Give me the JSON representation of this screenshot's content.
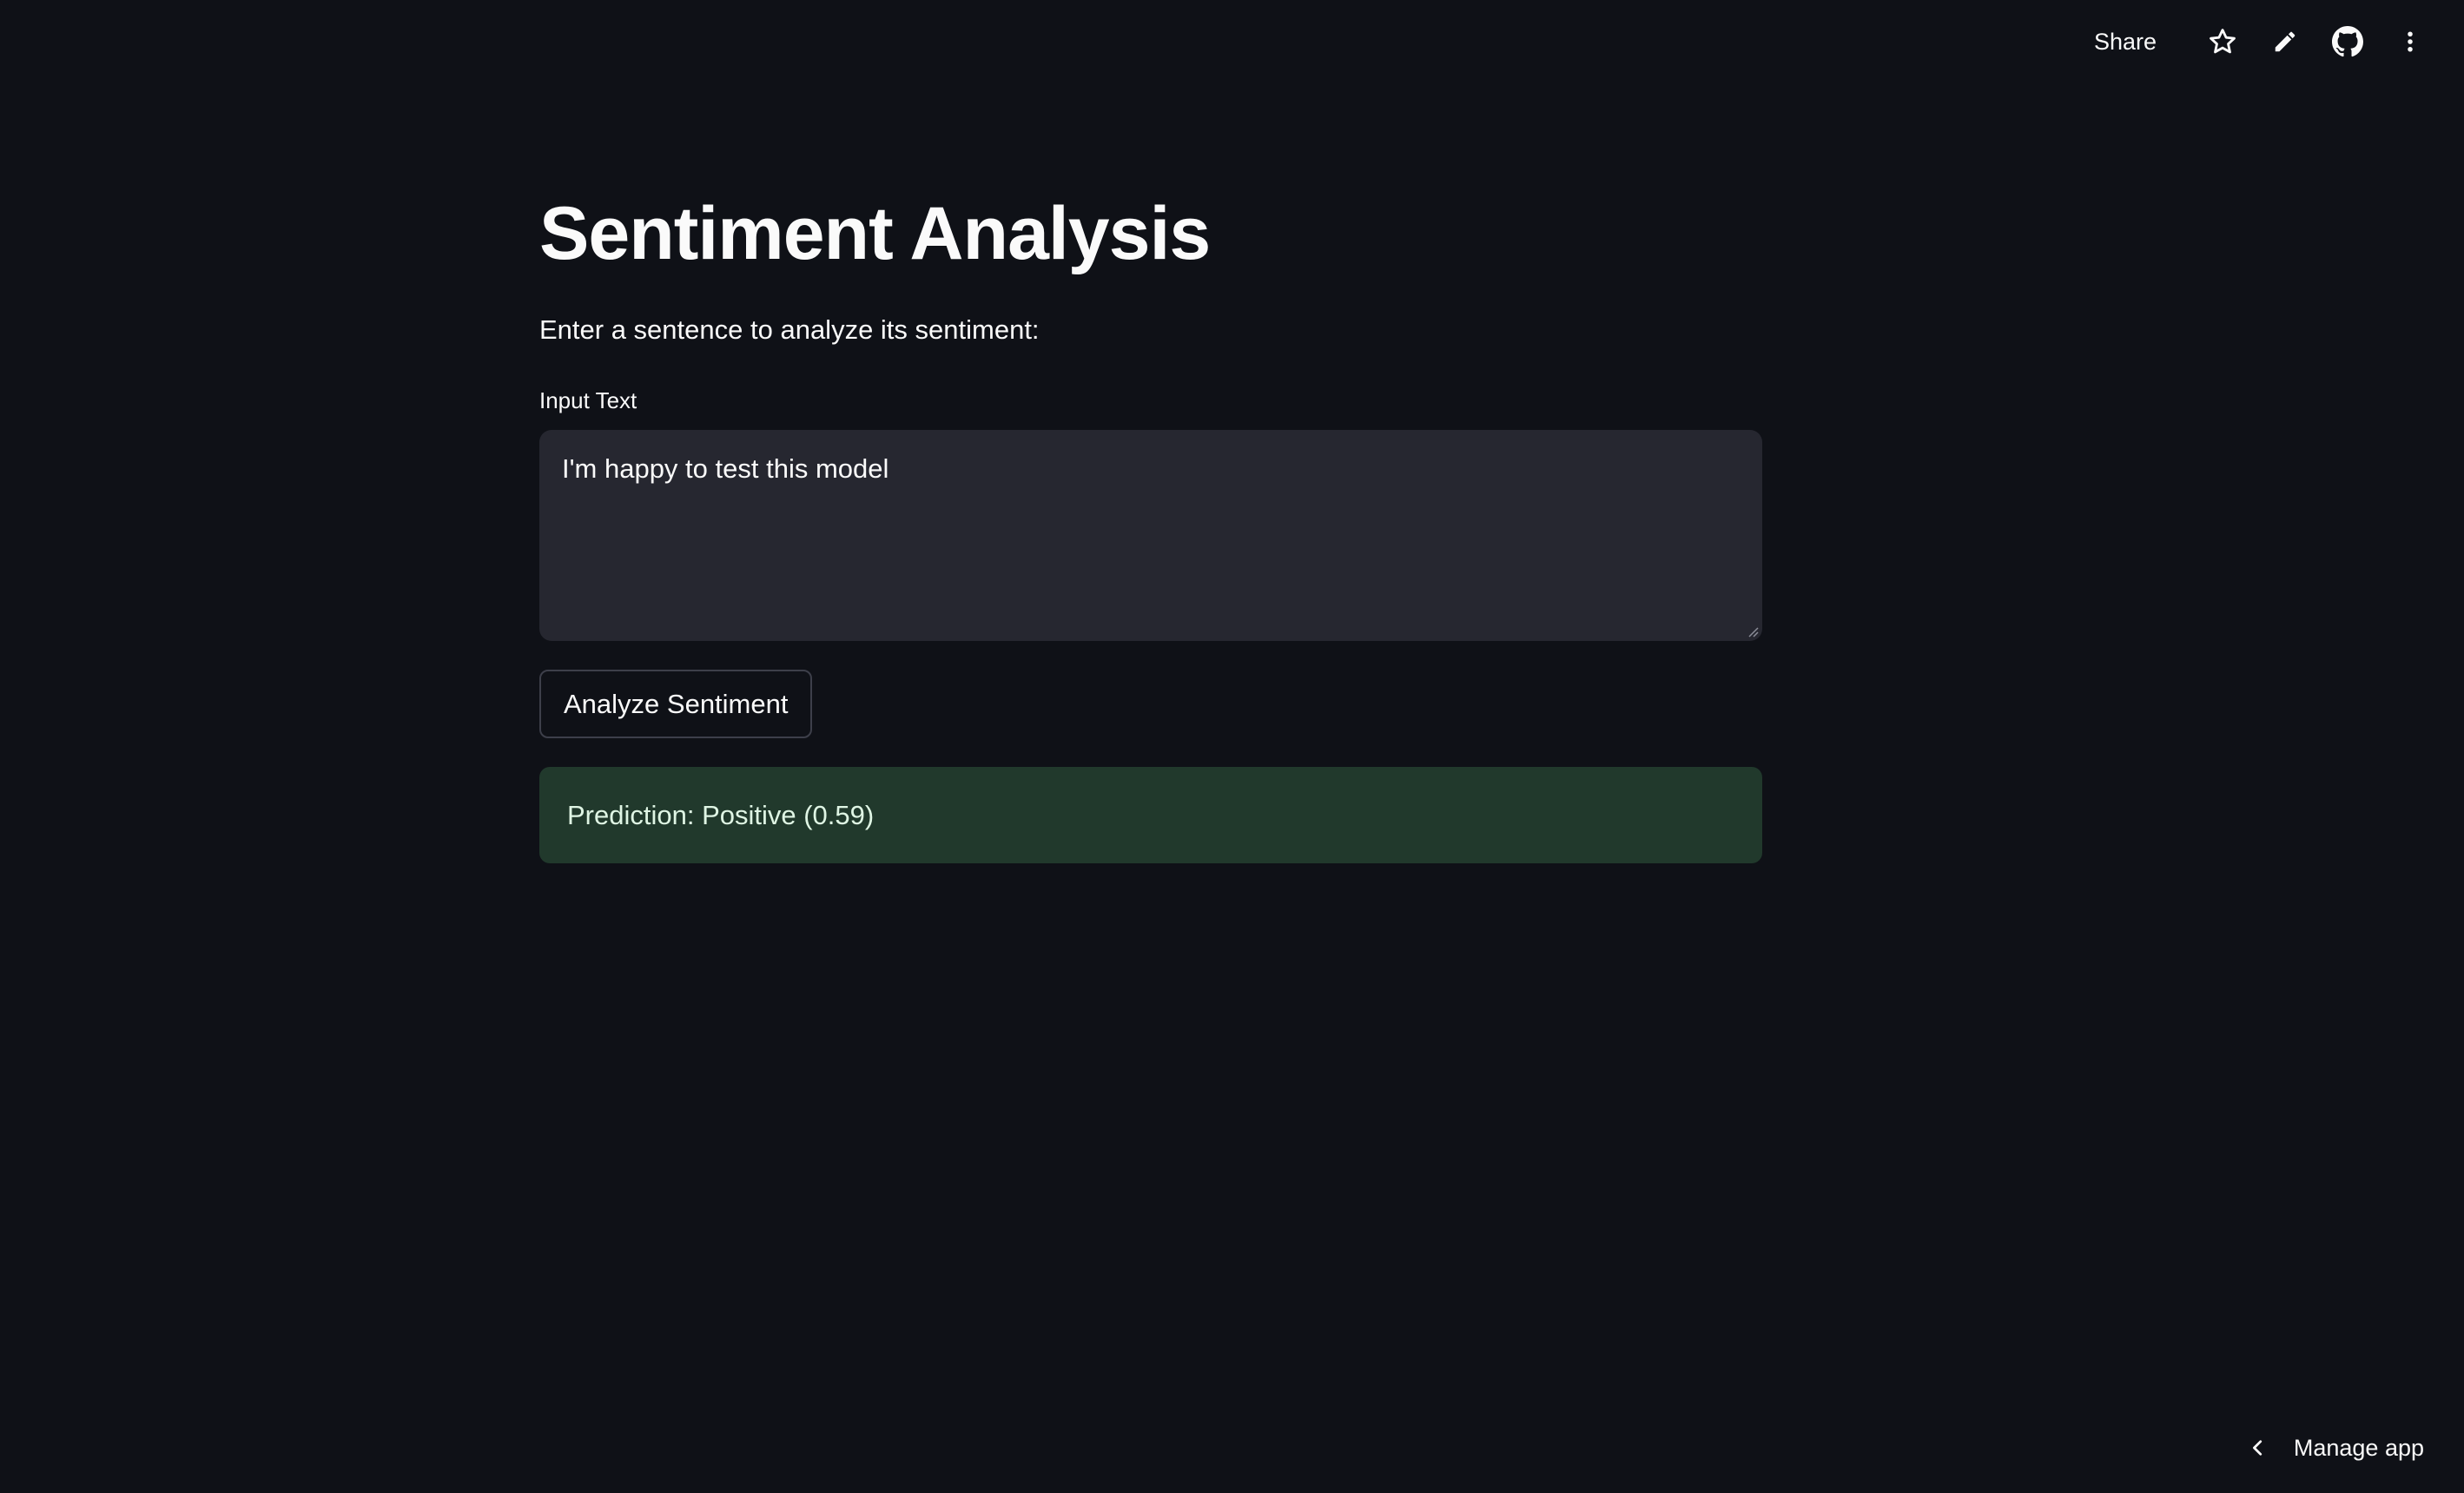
{
  "toolbar": {
    "share_label": "Share",
    "icons": [
      "star-icon",
      "pencil-icon",
      "github-icon",
      "more-vertical-icon"
    ]
  },
  "main": {
    "title": "Sentiment Analysis",
    "subtitle": "Enter a sentence to analyze its sentiment:",
    "input_label": "Input Text",
    "input_value": "I'm happy to test this model",
    "analyze_button_label": "Analyze Sentiment",
    "result_text": "Prediction: Positive (0.59)"
  },
  "footer": {
    "manage_app_label": "Manage app"
  },
  "colors": {
    "background": "#0f1117",
    "input_background": "#262730",
    "success_background": "#21392c",
    "text": "#fafafa"
  }
}
